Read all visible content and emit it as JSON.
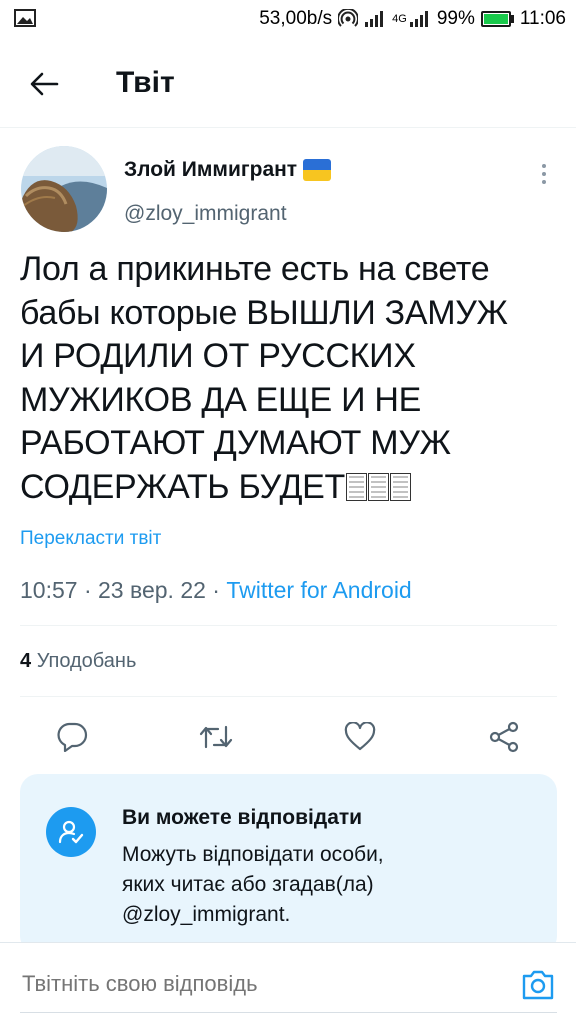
{
  "status_bar": {
    "speed": "53,00b/s",
    "network_label": "4G",
    "battery": "99%",
    "time": "11:06",
    "battery_color": "#19c94b"
  },
  "header": {
    "title": "Твіт",
    "back_icon": "arrow-left-icon"
  },
  "tweet": {
    "display_name": "Злой Иммигрант",
    "flag": "ukraine-flag",
    "handle": "@zloy_immigrant",
    "text": "Лол а прикиньте есть на свете\nбабы которые ВЫШЛИ ЗАМУЖ\nИ РОДИЛИ ОТ РУССКИХ\nМУЖИКОВ ДА ЕЩЕ И НЕ\nРАБОТАЮТ ДУМАЮТ МУЖ\nСОДЕРЖАТЬ БУДЕТ",
    "emoji_count": 3,
    "translate_label": "Перекласти твіт",
    "time": "10:57",
    "date": "23 вер. 22",
    "source": "Twitter for Android",
    "likes_count": "4",
    "likes_label": "Уподобань"
  },
  "actions": {
    "reply_icon": "reply-icon",
    "retweet_icon": "retweet-icon",
    "like_icon": "like-icon",
    "share_icon": "share-icon"
  },
  "reply_restriction": {
    "title": "Ви можете відповідати",
    "body": "Можуть відповідати особи,\nяких читає або згадав(ла)\n@zloy_immigrant."
  },
  "reply_bar": {
    "placeholder": "Твітніть свою відповідь",
    "camera_icon": "camera-icon"
  },
  "colors": {
    "accent": "#1d9bf0",
    "secondary_text": "#536471",
    "card_background": "#e8f5fd"
  }
}
